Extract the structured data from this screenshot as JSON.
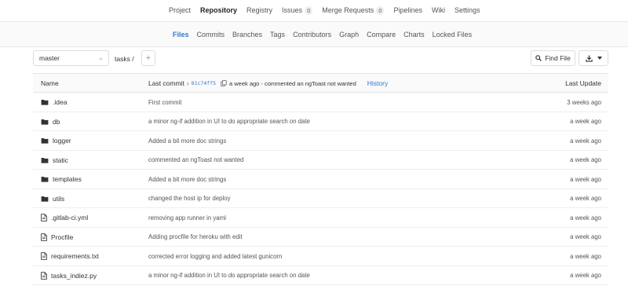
{
  "topnav": {
    "items": [
      {
        "label": "Project"
      },
      {
        "label": "Repository",
        "active": true
      },
      {
        "label": "Registry"
      },
      {
        "label": "Issues",
        "badge": "0"
      },
      {
        "label": "Merge Requests",
        "badge": "0"
      },
      {
        "label": "Pipelines"
      },
      {
        "label": "Wiki"
      },
      {
        "label": "Settings"
      }
    ]
  },
  "subnav": {
    "items": [
      "Files",
      "Commits",
      "Branches",
      "Tags",
      "Contributors",
      "Graph",
      "Compare",
      "Charts",
      "Locked Files"
    ],
    "active": "Files"
  },
  "toolbar": {
    "branch": "master",
    "path": "tasks /",
    "add_label": "+",
    "find_file_label": "Find File"
  },
  "table": {
    "header": {
      "name": "Name",
      "last_commit": "Last commit",
      "sha": "81c74ff5",
      "commit_info": "a week ago - commented an ngToast not wanted",
      "history": "History",
      "last_update": "Last Update"
    },
    "rows": [
      {
        "name": ".idea",
        "type": "folder",
        "commit": "First commit",
        "time": "3 weeks ago"
      },
      {
        "name": "db",
        "type": "folder",
        "commit": "a minor ng-if addition in UI to do appropriate search on date",
        "time": "a week ago"
      },
      {
        "name": "logger",
        "type": "folder",
        "commit": "Added a bit more doc strings",
        "time": "a week ago"
      },
      {
        "name": "static",
        "type": "folder",
        "commit": "commented an ngToast not wanted",
        "time": "a week ago"
      },
      {
        "name": "templates",
        "type": "folder",
        "commit": "Added a bit more doc strings",
        "time": "a week ago"
      },
      {
        "name": "utils",
        "type": "folder",
        "commit": "changed the host ip for deploy",
        "time": "a week ago"
      },
      {
        "name": ".gitlab-ci.yml",
        "type": "file",
        "commit": "removing app runner in yaml",
        "time": "a week ago"
      },
      {
        "name": "Procfile",
        "type": "file",
        "commit": "Adding procfile for heroku with edit",
        "time": "a week ago"
      },
      {
        "name": "requirements.txt",
        "type": "file",
        "commit": "corrected error logging and added latest gunicorn",
        "time": "a week ago"
      },
      {
        "name": "tasks_indiez.py",
        "type": "file",
        "commit": "a minor ng-if addition in UI to do appropriate search on date",
        "time": "a week ago"
      }
    ]
  },
  "colors": {
    "accent": "#2e7bcf",
    "text": "#333333",
    "muted": "#555555",
    "border": "#e5e5e5"
  },
  "icons": {
    "folder": "folder-icon",
    "file": "file-icon",
    "search": "search-icon",
    "download": "download-icon",
    "copy": "copy-icon"
  }
}
